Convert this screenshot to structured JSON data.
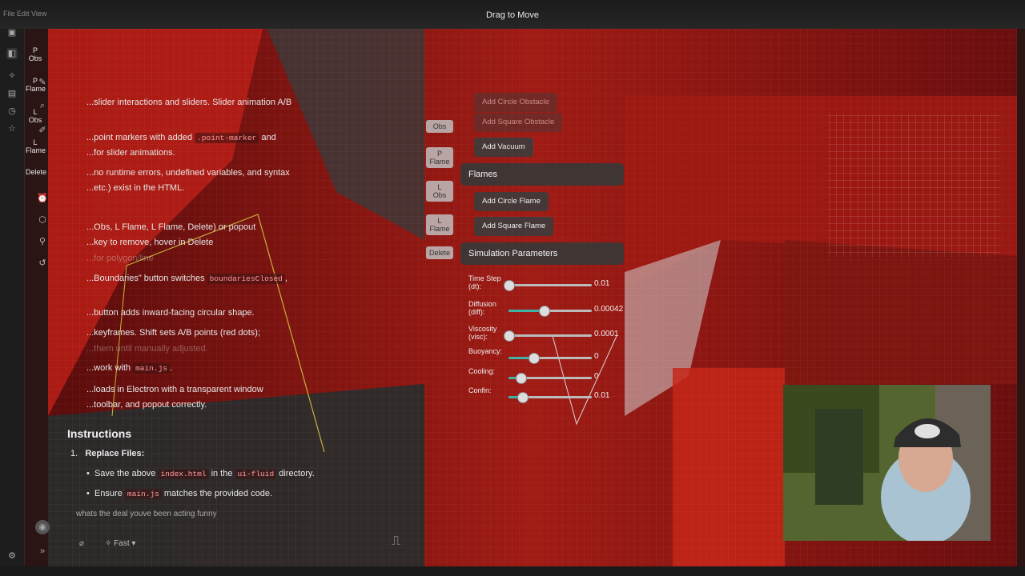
{
  "window": {
    "title": "Drag to Move",
    "menu": "File  Edit  View"
  },
  "rail": {
    "icons": [
      "window-icon",
      "sidebar-icon",
      "sparkle-icon",
      "files-icon",
      "history-icon",
      "star-icon",
      "settings-icon"
    ],
    "labels": {
      "p_obs": "P\nObs",
      "p_flame": "P\nFlame",
      "l_obs": "L\nObs",
      "l_flame": "L\nFlame",
      "delete": "Delete"
    }
  },
  "chat": {
    "lines": [
      {
        "text": "...slider interactions and sliders. Slider animation A/B",
        "dim": false
      },
      {
        "text": "...point markers with added",
        "code": ".point-marker",
        "after": "and",
        "dim": false
      },
      {
        "text": "...for slider animations.",
        "dim": false
      },
      {
        "text": "...no runtime errors, undefined variables, and syntax",
        "dim": false
      },
      {
        "text": "...etc.) exist in the HTML.",
        "dim": false
      },
      {
        "text": "...Obs, L Flame, L Flame, Delete) or popout",
        "dim": false
      },
      {
        "text": "...key to remove, hover in Delete",
        "dim": false
      },
      {
        "text": "...for polygon/line",
        "dim": true
      },
      {
        "text": "...Boundaries\" button switches",
        "code": "boundariesClosed",
        "after": ",",
        "dim": false
      },
      {
        "text": "...button adds inward-facing circular shape.",
        "dim": false
      },
      {
        "text": "...keyframes. Shift sets A/B points (red dots);",
        "dim": false
      },
      {
        "text": "...them until manually adjusted.",
        "dim": true
      },
      {
        "text": "...work with",
        "code": "main.js",
        "after": ".",
        "dim": false
      },
      {
        "text": "...loads in Electron with a transparent window",
        "dim": false
      },
      {
        "text": "...toolbar, and popout correctly.",
        "dim": false
      }
    ],
    "instructions_title": "Instructions",
    "step1_num": "1.",
    "step1_title": "Replace Files:",
    "bullet1_pre": "Save the above",
    "bullet1_code": "index.html",
    "bullet1_mid": "in the",
    "bullet1_code2": "ui-fluid",
    "bullet1_post": "directory.",
    "bullet2_pre": "Ensure",
    "bullet2_code": "main.js",
    "bullet2_post": "matches the provided code.",
    "composer_text": "whats the deal youve been acting funny",
    "model": "Fast"
  },
  "controls": {
    "side_buttons": [
      "Obs",
      "P\nFlame",
      "L\nObs",
      "L\nFlame",
      "Delete"
    ],
    "top_buttons": [
      "Add Circle Obstacle",
      "Add Square Obstacle",
      "Add Vacuum"
    ],
    "flames_title": "Flames",
    "flame_buttons": [
      "Add Circle Flame",
      "Add Square Flame"
    ],
    "sim_title": "Simulation Parameters",
    "sliders": [
      {
        "label": "Time Step\n(dt):",
        "value": "0.01",
        "fraction": 0.0
      },
      {
        "label": "Diffusion\n(diff):",
        "value": "0.00042",
        "fraction": 0.42
      },
      {
        "label": "Viscosity\n(visc):",
        "value": "0.0001",
        "fraction": 0.0
      },
      {
        "label": "Buoyancy:",
        "value": "0",
        "fraction": 0.3
      },
      {
        "label": "Cooling:",
        "value": "0",
        "fraction": 0.14
      },
      {
        "label": "Confin:",
        "value": "0.01",
        "fraction": 0.16
      }
    ]
  }
}
